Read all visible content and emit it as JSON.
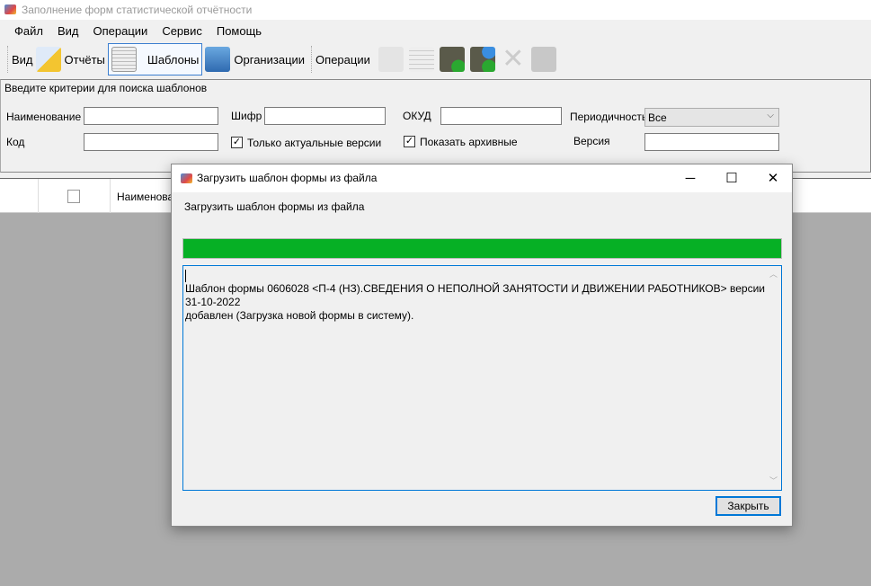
{
  "app": {
    "title": "Заполнение форм статистической отчётности"
  },
  "menu": [
    "Файл",
    "Вид",
    "Операции",
    "Сервис",
    "Помощь"
  ],
  "toolbar": {
    "view_label": "Вид",
    "reports": "Отчёты",
    "templates": "Шаблоны",
    "organizations": "Организации",
    "operations_label": "Операции"
  },
  "search": {
    "heading": "Введите критерии для поиска шаблонов",
    "name_label": "Наименование",
    "name_value": "",
    "cipher_label": "Шифр",
    "cipher_value": "",
    "okud_label": "ОКУД",
    "okud_value": "",
    "period_label": "Периодичность",
    "period_value": "Все",
    "code_label": "Код",
    "code_value": "",
    "only_actual_label": "Только актуальные версии",
    "only_actual_checked": true,
    "show_archive_label": "Показать архивные",
    "show_archive_checked": true,
    "version_label": "Версия",
    "version_value": ""
  },
  "grid": {
    "col_name": "Наименова"
  },
  "dialog": {
    "title": "Загрузить шаблон формы из файла",
    "caption": "Загрузить шаблон формы из файла",
    "progress_percent": 100,
    "log_line1": "Шаблон формы 0606028 <П-4 (НЗ).СВЕДЕНИЯ О НЕПОЛНОЙ ЗАНЯТОСТИ И ДВИЖЕНИИ РАБОТНИКОВ> версии 31-10-2022",
    "log_line2": "добавлен (Загрузка новой формы в систему).",
    "close_label": "Закрыть"
  },
  "colors": {
    "progress": "#06b025",
    "accent": "#0078d7"
  }
}
